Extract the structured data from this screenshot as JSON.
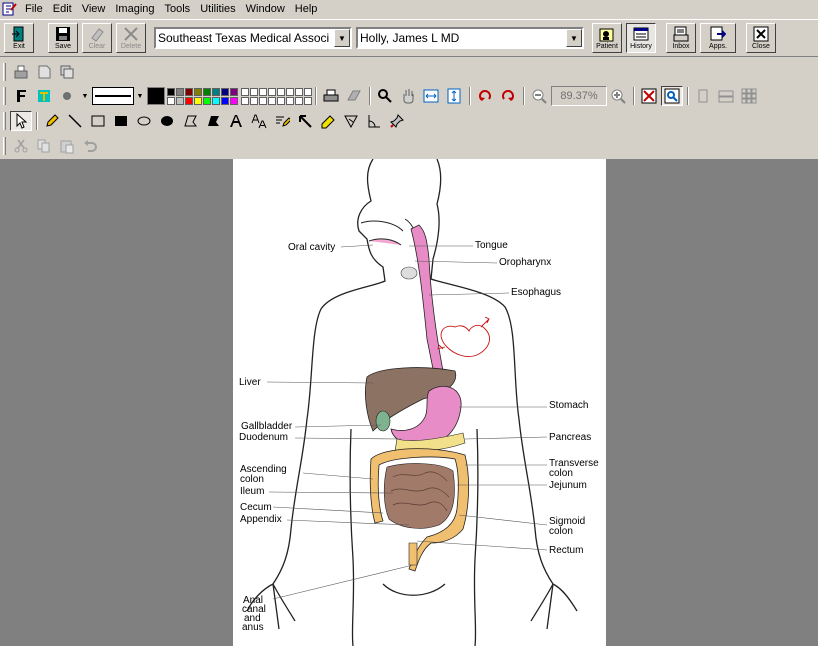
{
  "menu": {
    "items": [
      "File",
      "Edit",
      "View",
      "Imaging",
      "Tools",
      "Utilities",
      "Window",
      "Help"
    ]
  },
  "toolbar": {
    "exit_label": "Exit",
    "save_label": "Save",
    "clear_label": "Clear",
    "delete_label": "Delete",
    "organization": "Southeast Texas Medical Associ",
    "provider": "Holly, James  L MD",
    "patient_label": "Patient",
    "history_label": "History",
    "inbox_label": "Inbox",
    "apps_label": "Apps.",
    "close_label": "Close"
  },
  "drawing": {
    "zoom": "89.37%",
    "palette": [
      "#000000",
      "#808080",
      "#800000",
      "#808000",
      "#008000",
      "#008080",
      "#000080",
      "#800080",
      "#ffffff",
      "#c0c0c0",
      "#ff0000",
      "#ffff00",
      "#00ff00",
      "#00ffff",
      "#0000ff",
      "#ff00ff"
    ]
  },
  "diagram": {
    "labels": {
      "oral_cavity": "Oral cavity",
      "tongue": "Tongue",
      "oropharynx": "Oropharynx",
      "esophagus": "Esophagus",
      "liver": "Liver",
      "stomach": "Stomach",
      "gallbladder": "Gallbladder",
      "duodenum": "Duodenum",
      "pancreas": "Pancreas",
      "ascending_colon_1": "Ascending",
      "ascending_colon_2": "colon",
      "transverse_colon_1": "Transverse",
      "transverse_colon_2": "colon",
      "ileum": "Ileum",
      "jejunum": "Jejunum",
      "cecum": "Cecum",
      "appendix": "Appendix",
      "sigmoid_colon_1": "Sigmoid",
      "sigmoid_colon_2": "colon",
      "rectum": "Rectum",
      "anal_canal_1": "Anal",
      "anal_canal_2": "canal",
      "anal_canal_3": "and",
      "anal_canal_4": "anus"
    }
  }
}
